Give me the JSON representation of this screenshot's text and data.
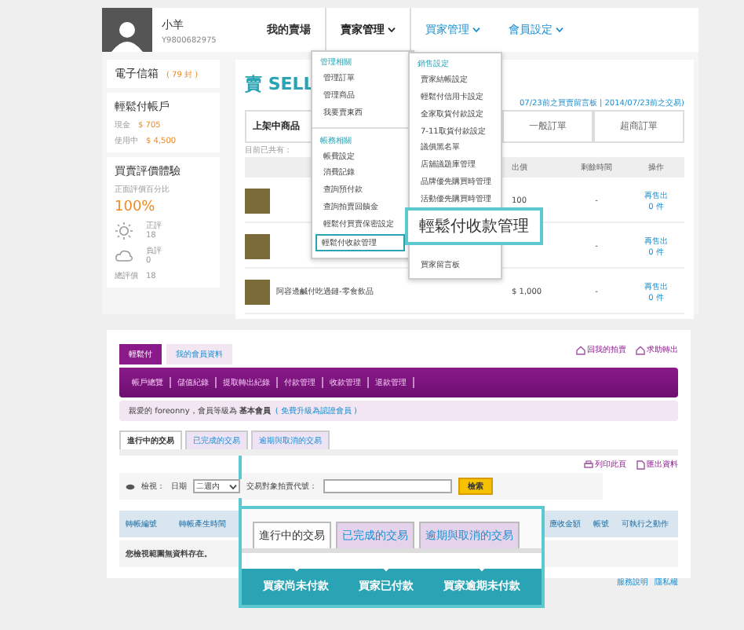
{
  "profile": {
    "name": "小羊",
    "member_id": "Y9800682975"
  },
  "nav": [
    {
      "label": "我的賣場",
      "selected": false,
      "has_menu": false
    },
    {
      "label": "賣家管理",
      "selected": true,
      "has_menu": true
    },
    {
      "label": "買家管理",
      "selected": false,
      "has_menu": true
    },
    {
      "label": "會員設定",
      "selected": false,
      "has_menu": true
    }
  ],
  "sidebar": {
    "mail": {
      "label": "電子信箱",
      "count": "( 79 封 )"
    },
    "wallet": {
      "title": "輕鬆付帳戶",
      "rows": [
        {
          "label": "現金",
          "value": "$ 705"
        },
        {
          "label": "使用中",
          "value": "$ 4,500"
        }
      ]
    },
    "rating": {
      "title": "買賣評價體驗",
      "caption": "正面評價百分比",
      "percent": "100%",
      "rows": [
        {
          "kind": "positive",
          "label": "正評",
          "value": "18"
        },
        {
          "kind": "negative",
          "label": "負評",
          "value": "0"
        }
      ],
      "total_label": "總評價",
      "total": "18"
    }
  },
  "main": {
    "title": "賣 SELL",
    "notice": "07/23前之買賣留言板 | 2014/07/23前之交易)",
    "tabs": [
      {
        "label": "上架中商品",
        "selected": true
      },
      {
        "label": "一般訂單",
        "selected": false
      },
      {
        "label": "超商訂單",
        "selected": false
      }
    ],
    "count_label": "目前已共有：",
    "columns": [
      "出價",
      "剩餘時間",
      "操作"
    ],
    "rows": [
      {
        "name": "",
        "price": "100",
        "time": "-",
        "action": "再售出",
        "qty": "0 件"
      },
      {
        "name": "",
        "price": "",
        "time": "-",
        "action": "再售出",
        "qty": "0 件"
      },
      {
        "name": "阿容邊鹹付吃過鏈-零食飲品",
        "price": "$ 1,000",
        "time": "-",
        "action": "再售出",
        "qty": "0 件"
      }
    ]
  },
  "seller_menu": [
    {
      "heading": "管理相關",
      "items": [
        {
          "label": "管理訂單",
          "selected": false
        },
        {
          "label": "管理商品",
          "selected": false
        },
        {
          "label": "我要賣東西",
          "selected": false
        }
      ]
    },
    {
      "heading": "帳務相關",
      "items": [
        {
          "label": "帳費設定",
          "selected": false
        },
        {
          "label": "消費記錄",
          "selected": false
        },
        {
          "label": "查詢預付款",
          "selected": false
        },
        {
          "label": "查詢拍賣回饋金",
          "selected": false
        },
        {
          "label": "輕鬆付買賣保密設定",
          "selected": false
        },
        {
          "label": "輕鬆付收款管理",
          "selected": true
        }
      ]
    }
  ],
  "settings_menu": [
    {
      "heading": "銷售設定",
      "items": [
        {
          "label": "賣家結帳設定",
          "selected": false
        },
        {
          "label": "輕鬆付信用卡設定",
          "selected": false
        },
        {
          "label": "全家取貨付款設定",
          "selected": false
        },
        {
          "label": "7-11取貨付款設定",
          "selected": false
        },
        {
          "label": "議價黑名單",
          "selected": false
        },
        {
          "label": "店舖議題庫管理",
          "selected": false
        },
        {
          "label": "品牌優先購買時管理",
          "selected": false
        },
        {
          "label": "活動優先購買時管理",
          "selected": false
        },
        {
          "label": "買家留言板",
          "selected": false
        }
      ]
    }
  ],
  "top_callout": "輕鬆付收款管理",
  "account": {
    "tabs": [
      {
        "label": "輕鬆付",
        "selected": true
      },
      {
        "label": "我的會員資料",
        "selected": false
      }
    ],
    "links": [
      "回我的拍賣",
      "求助轉出"
    ],
    "menu": [
      "帳戶總覽",
      "儲值紀錄",
      "提取轉出紀錄",
      "付款管理",
      "收款管理",
      "退款管理"
    ],
    "notice": "親愛的 foreonny，會員等級為 **基本會員**",
    "notice_link": "( 免費升級為認證會員 )",
    "tx_tabs": [
      {
        "label": "進行中的交易",
        "selected": true
      },
      {
        "label": "已完成的交易",
        "selected": false
      },
      {
        "label": "逾期與取消的交易",
        "selected": false
      }
    ],
    "tools": [
      "列印此頁",
      "匯出資料"
    ],
    "filter": {
      "view_label": "檢視：",
      "date_label": "日期",
      "date_value": "二週內",
      "partner_label": "交易對象拍賣代號：",
      "button": "檢索"
    },
    "columns": [
      "轉帳編號",
      "轉帳產生時間",
      "應收金額",
      "帳號",
      "可執行之動作"
    ],
    "empty": "您檢視範圍無資料存在。",
    "footer_links": [
      "服務說明",
      "隱私權"
    ]
  },
  "bottom_callout": {
    "tabs": [
      {
        "label": "進行中的交易",
        "selected": true
      },
      {
        "label": "已完成的交易",
        "selected": false
      },
      {
        "label": "逾期與取消的交易",
        "selected": false
      }
    ],
    "statuses": [
      "買家尚未付款",
      "買家已付款",
      "買家逾期未付款"
    ]
  }
}
